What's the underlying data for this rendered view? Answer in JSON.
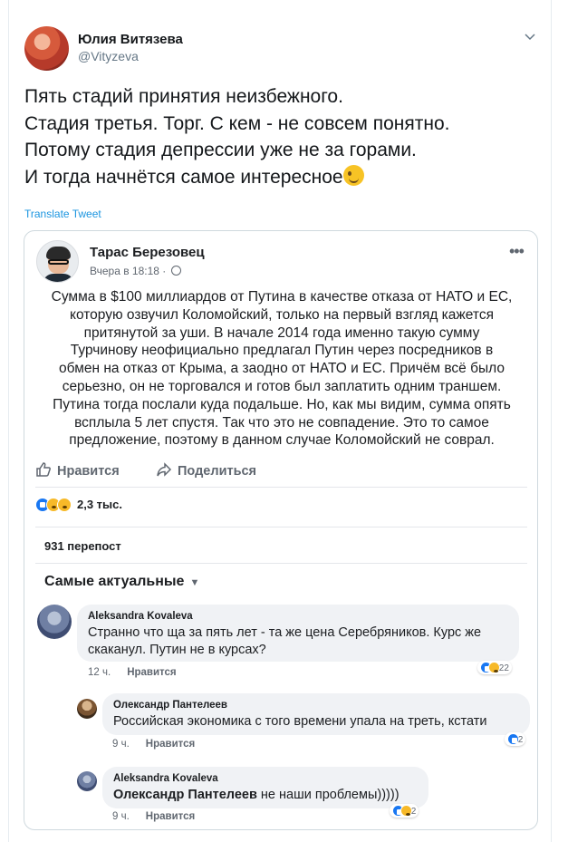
{
  "tweet": {
    "author_name": "Юлия Витязева",
    "author_handle": "@Vityzeva",
    "text_lines": [
      "Пять стадий принятия неизбежного.",
      "Стадия третья. Торг. С кем - не совсем понятно.",
      "Потому стадия депрессии уже не за горами.",
      "И тогда начнётся самое интересное"
    ],
    "translate_label": "Translate Tweet"
  },
  "fb_post": {
    "author_name": "Тарас Березовец",
    "time": "Вчера в 18:18 ·",
    "more": "•••",
    "text_lines": [
      "Сумма в $100 миллиардов от Путина в качестве отказа от НАТО и ЕС,",
      "которую озвучил Коломойский, только на первый взгляд кажется",
      "притянутой за уши. В начале 2014 года именно такую сумму",
      "Турчинову неофициально предлагал Путин через посредников в",
      "обмен на отказ от Крыма, а заодно от НАТО и ЕС. Причём всё было",
      "серьезно, он не торговался и готов был заплатить одним траншем.",
      "Путина тогда послали куда подальше. Но, как мы видим, сумма опять",
      "всплыла 5 лет спустя. Так что это не совпадение. Это то самое",
      "предложение, поэтому в данном случае Коломойский не соврал."
    ],
    "like_label": "Нравится",
    "share_label": "Поделиться",
    "reactions_count": "2,3 тыс.",
    "reposts": "931 перепост",
    "sort_label": "Самые актуальные",
    "comments": [
      {
        "name": "Aleksandra Kovaleva",
        "lines": [
          "Странно что ща за пять лет - та же цена Серебряников. Курс же",
          "скаканул. Путин не в курсах?"
        ],
        "time": "12 ч.",
        "like": "Нравится",
        "reactions": "22"
      },
      {
        "name": "Олександр Пантелеев",
        "lines": [
          "Российская экономика с того времени упала на треть, кстати"
        ],
        "time": "9 ч.",
        "like": "Нравится",
        "reactions": "2"
      },
      {
        "name": "Aleksandra Kovaleva",
        "mention": "Олександр Пантелеев",
        "text": " не наши проблемы)))))",
        "time": "9 ч.",
        "like": "Нравится",
        "reactions": "2"
      }
    ]
  },
  "icons": {
    "caret": "chevron-down-icon",
    "globe": "globe-icon",
    "like": "thumbs-up-icon",
    "share": "share-arrow-icon",
    "emoji": "winking-face-emoji"
  },
  "colors": {
    "link": "#1b95e0",
    "fb_blue": "#1877f2",
    "bubble": "#f0f2f5",
    "muted": "#657786"
  }
}
